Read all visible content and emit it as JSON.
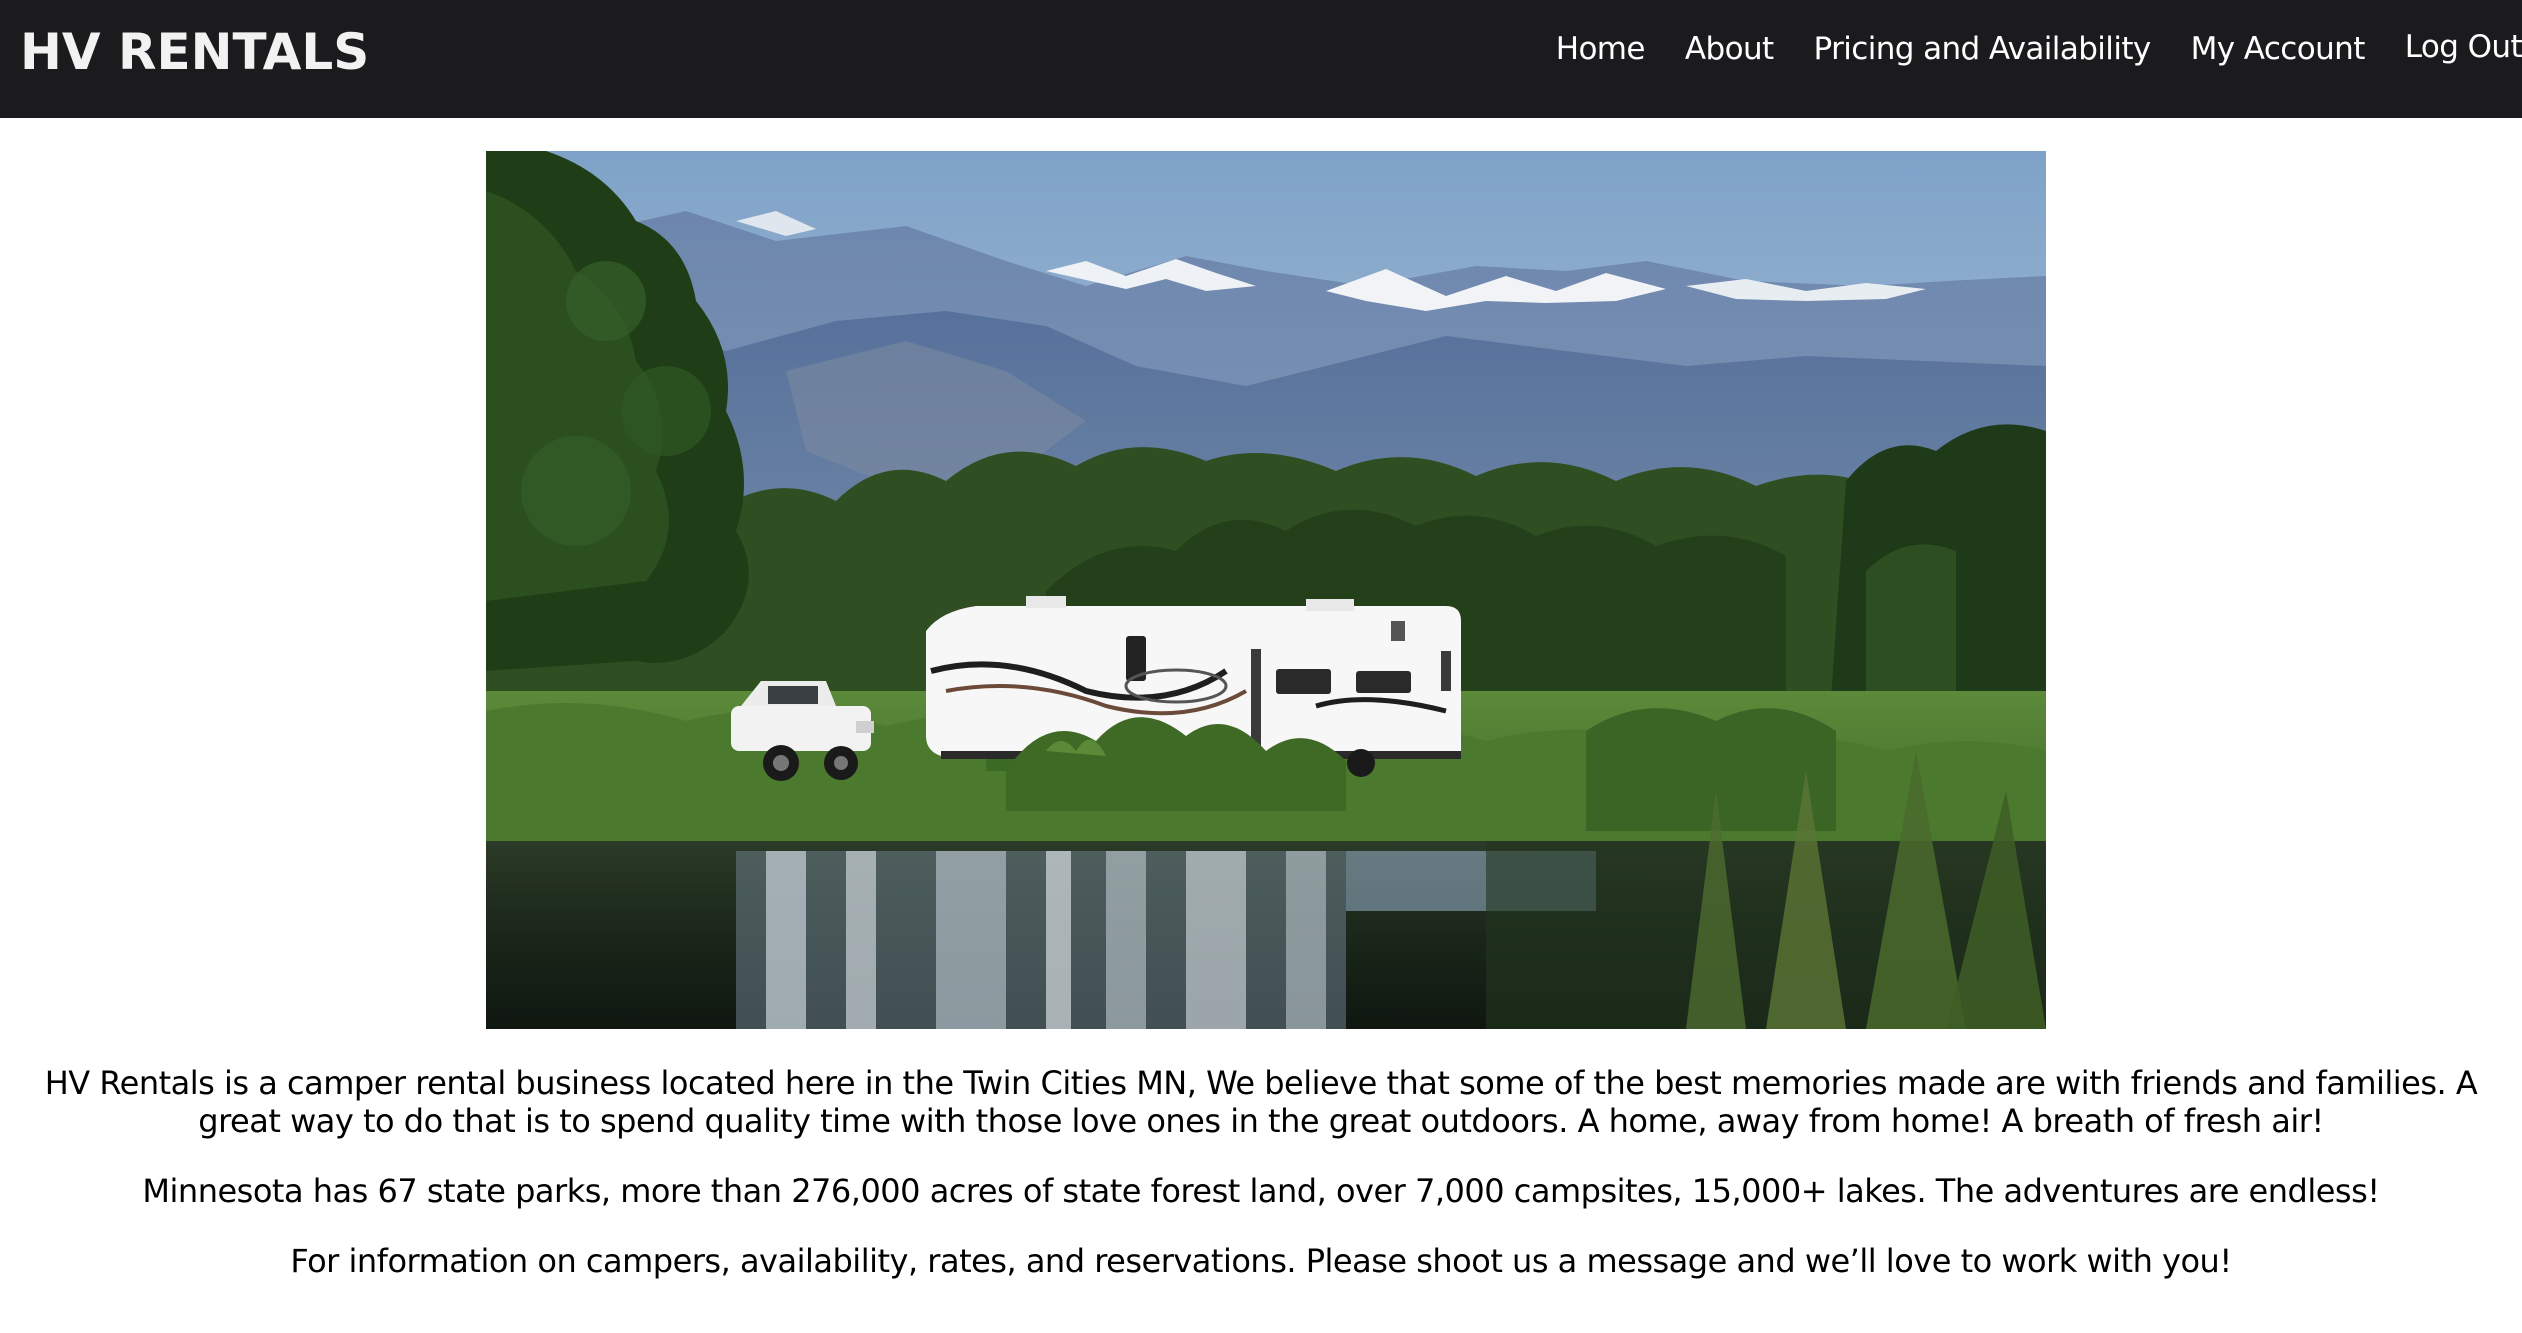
{
  "app": {
    "brand": "HV RENTALS"
  },
  "nav": {
    "items": [
      {
        "label": "Home"
      },
      {
        "label": "About"
      },
      {
        "label": "Pricing and Availability"
      },
      {
        "label": "My Account"
      },
      {
        "label": "Log Out"
      }
    ]
  },
  "hero": {
    "image_subject": "fifth-wheel camper and white pickup truck beside a lake with snow-capped mountains"
  },
  "main": {
    "paragraphs": [
      "HV Rentals is a camper rental business located here in the Twin Cities MN, We believe that some of the best memories made are with friends and families. A great way to do that is to spend quality time with those love ones in the great outdoors. A home, away from home! A breath of fresh air!",
      "Minnesota has 67 state parks, more than 276,000 acres of state forest land, over 7,000 campsites, 15,000+ lakes. The adventures are endless!",
      "For information on campers, availability, rates, and reservations. Please shoot us a message and we’ll love to work with you!"
    ]
  },
  "colors": {
    "navbar_bg": "#1b1a1d",
    "nav_text": "#ffffff",
    "body_bg": "#ffffff",
    "body_text": "#000000"
  }
}
